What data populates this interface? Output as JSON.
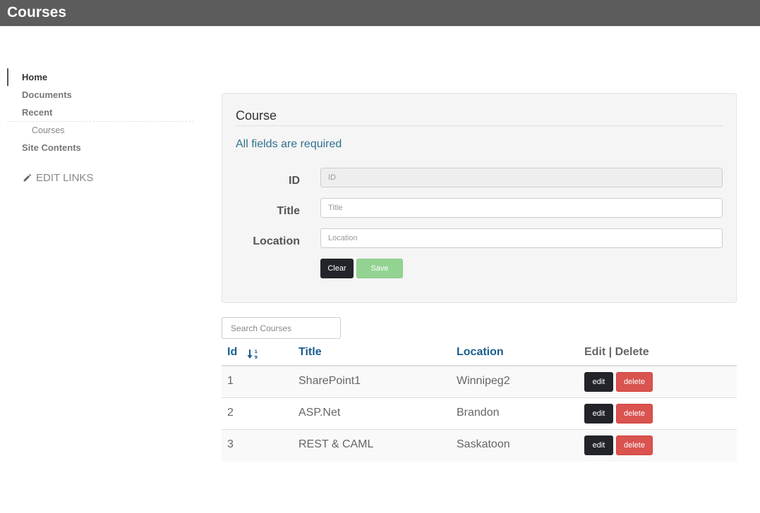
{
  "header": {
    "title": "Courses"
  },
  "nav": {
    "items": [
      {
        "label": "Home",
        "selected": true
      },
      {
        "label": "Documents"
      },
      {
        "label": "Recent"
      },
      {
        "label": "Courses",
        "sub": true
      },
      {
        "label": "Site Contents"
      }
    ],
    "edit_links": "EDIT LINKS"
  },
  "form": {
    "legend": "Course",
    "required_note": "All fields are required",
    "fields": [
      {
        "label": "ID",
        "placeholder": "ID",
        "value": ""
      },
      {
        "label": "Title",
        "placeholder": "Title",
        "value": ""
      },
      {
        "label": "Location",
        "placeholder": "Location",
        "value": ""
      }
    ],
    "clear_label": "Clear",
    "save_label": "Save"
  },
  "search": {
    "placeholder": "Search Courses",
    "value": ""
  },
  "table": {
    "columns": {
      "id": "Id",
      "title": "Title",
      "location": "Location",
      "actions": "Edit | Delete"
    },
    "rows": [
      {
        "id": "1",
        "title": "SharePoint1",
        "location": "Winnipeg2"
      },
      {
        "id": "2",
        "title": "ASP.Net",
        "location": "Brandon"
      },
      {
        "id": "3",
        "title": "REST & CAML",
        "location": "Saskatoon"
      }
    ],
    "edit_label": "edit",
    "delete_label": "delete"
  },
  "colors": {
    "header_bg": "#5c5c5c",
    "link": "#1a5e8e",
    "dark_button": "#222429",
    "save_button": "#92d392",
    "delete_button": "#d9534f",
    "info_text": "#31708f"
  },
  "icons": {
    "edit_links": "pencil-icon",
    "sort": "sort-numeric-asc-icon"
  }
}
